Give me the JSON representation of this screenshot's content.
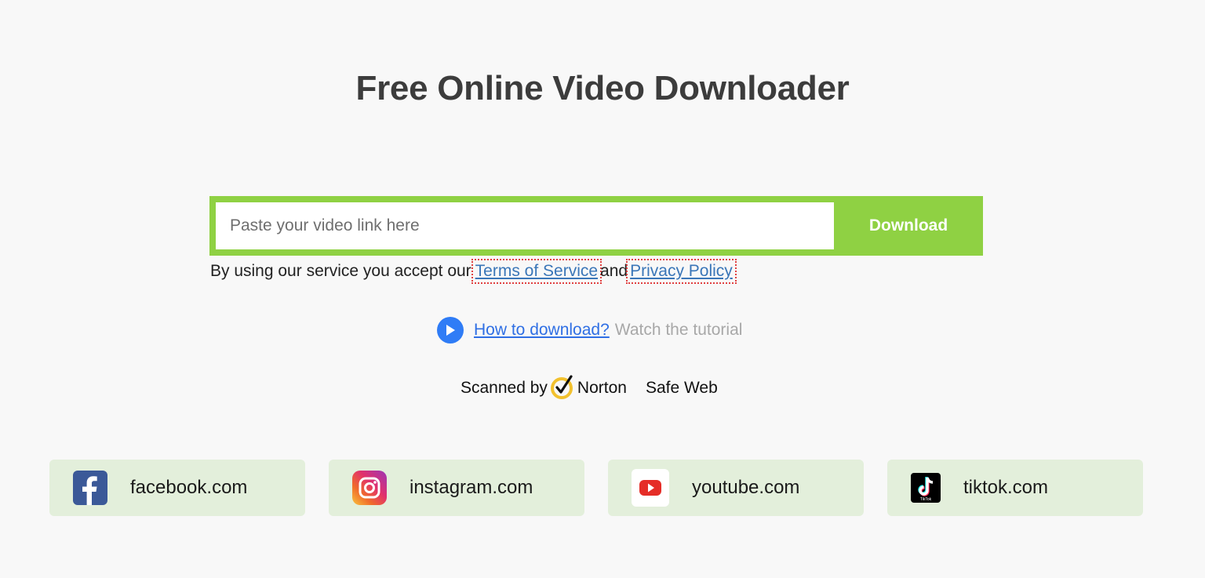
{
  "page": {
    "title": "Free Online Video Downloader"
  },
  "search": {
    "placeholder": "Paste your video link here",
    "value": "",
    "button_label": "Download"
  },
  "terms": {
    "prefix": "By using our service you accept our",
    "terms_link": "Terms of Service",
    "conjunction": "and",
    "privacy_link": "Privacy Policy"
  },
  "tutorial": {
    "icon": "play-icon",
    "link": "How to download?",
    "suffix": "Watch the tutorial"
  },
  "norton": {
    "prefix": "Scanned by",
    "icon": "norton-check-icon",
    "brand": "Norton",
    "product": "Safe Web"
  },
  "sites": [
    {
      "icon": "facebook-icon",
      "label": "facebook.com"
    },
    {
      "icon": "instagram-icon",
      "label": "instagram.com"
    },
    {
      "icon": "youtube-icon",
      "label": "youtube.com"
    },
    {
      "icon": "tiktok-icon",
      "label": "tiktok.com"
    }
  ],
  "colors": {
    "background": "#f8f8f8",
    "accent": "#8fd143",
    "card": "#e3efdb",
    "link": "#3a76b8",
    "play": "#2f7cf6"
  }
}
